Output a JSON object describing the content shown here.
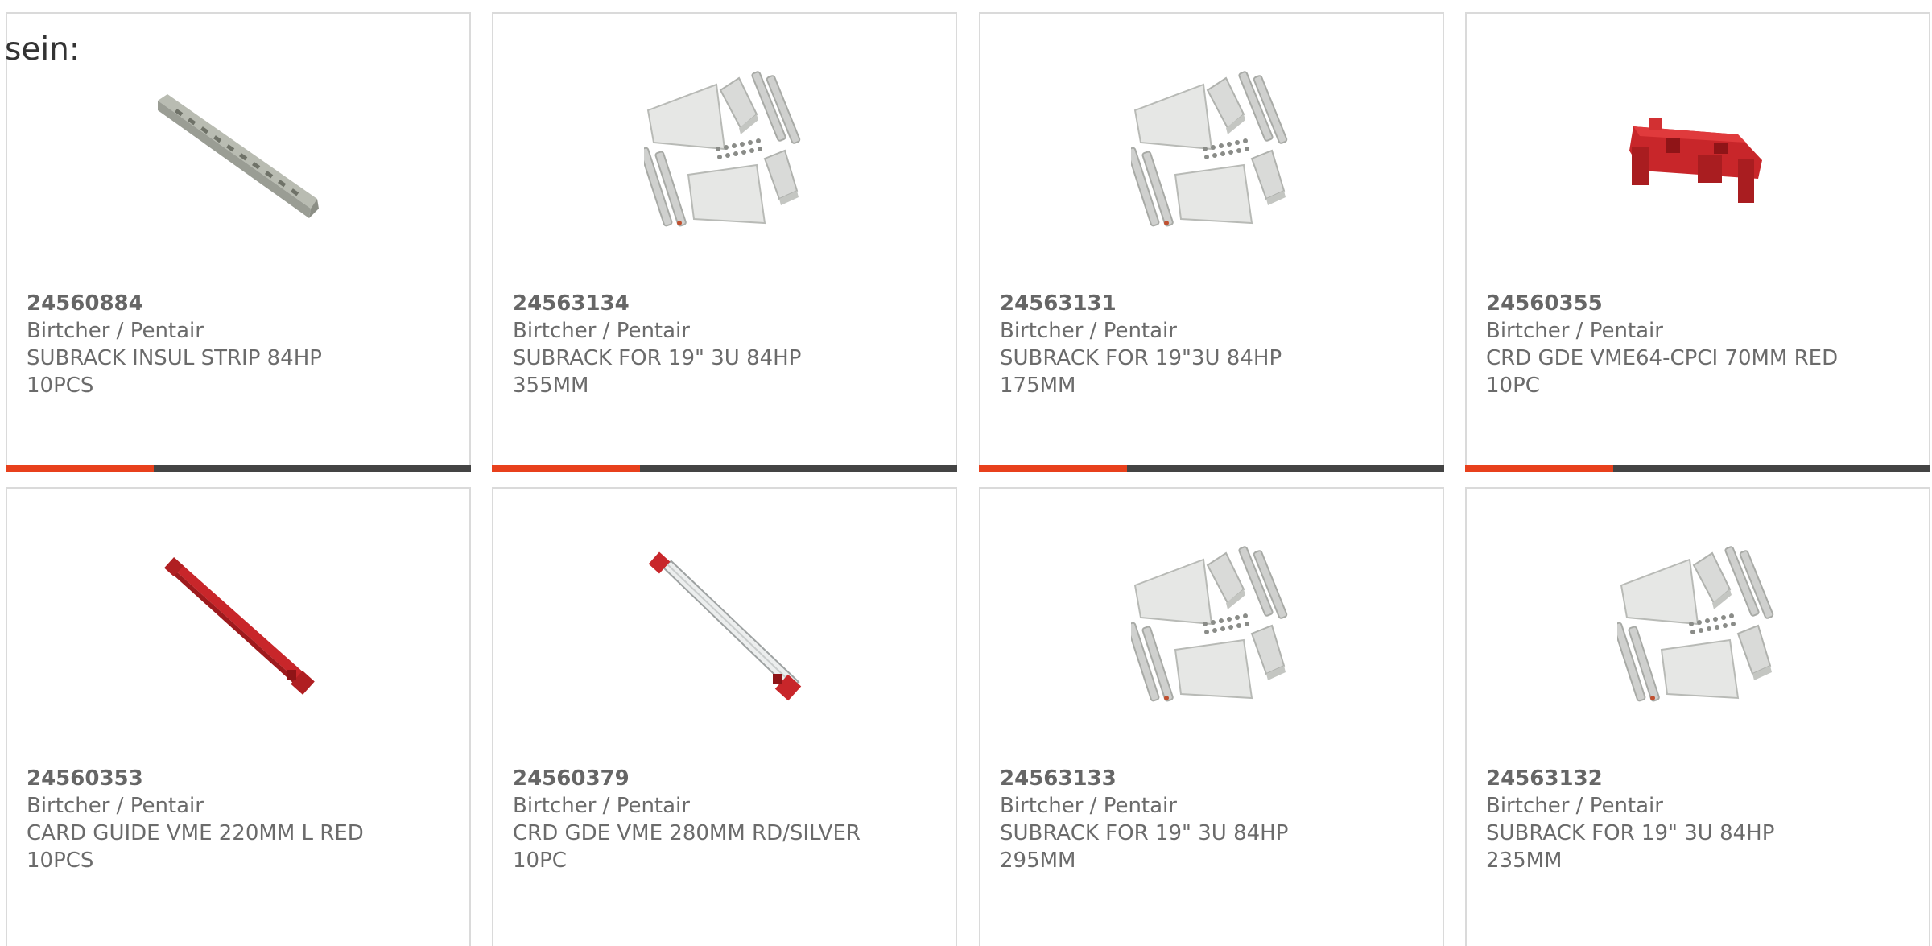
{
  "heading": "sein:",
  "colors": {
    "accent": "#e8401c",
    "bar_dark": "#444444",
    "border": "#dadada",
    "text": "#6b6b6b"
  },
  "products": [
    {
      "part_number": "24560884",
      "manufacturer": "Birtcher / Pentair",
      "desc1": "SUBRACK INSUL STRIP 84HP",
      "desc2": "10PCS",
      "image_icon": "insulating-strip-icon"
    },
    {
      "part_number": "24563134",
      "manufacturer": "Birtcher / Pentair",
      "desc1": "SUBRACK FOR 19\" 3U 84HP",
      "desc2": "355MM",
      "image_icon": "subrack-kit-icon"
    },
    {
      "part_number": "24563131",
      "manufacturer": "Birtcher / Pentair",
      "desc1": "SUBRACK FOR 19\"3U 84HP",
      "desc2": "175MM",
      "image_icon": "subrack-kit-icon"
    },
    {
      "part_number": "24560355",
      "manufacturer": "Birtcher / Pentair",
      "desc1": "CRD GDE VME64-CPCI 70MM RED",
      "desc2": "10PC",
      "image_icon": "red-card-guide-short-icon"
    },
    {
      "part_number": "24560353",
      "manufacturer": "Birtcher / Pentair",
      "desc1": "CARD GUIDE VME 220MM L RED",
      "desc2": "10PCS",
      "image_icon": "red-card-guide-long-icon"
    },
    {
      "part_number": "24560379",
      "manufacturer": "Birtcher / Pentair",
      "desc1": "CRD GDE VME 280MM RD/SILVER",
      "desc2": "10PC",
      "image_icon": "silver-card-guide-icon"
    },
    {
      "part_number": "24563133",
      "manufacturer": "Birtcher / Pentair",
      "desc1": "SUBRACK FOR 19\" 3U 84HP",
      "desc2": "295MM",
      "image_icon": "subrack-kit-icon"
    },
    {
      "part_number": "24563132",
      "manufacturer": "Birtcher / Pentair",
      "desc1": "SUBRACK FOR 19\" 3U 84HP",
      "desc2": "235MM",
      "image_icon": "subrack-kit-icon"
    }
  ]
}
